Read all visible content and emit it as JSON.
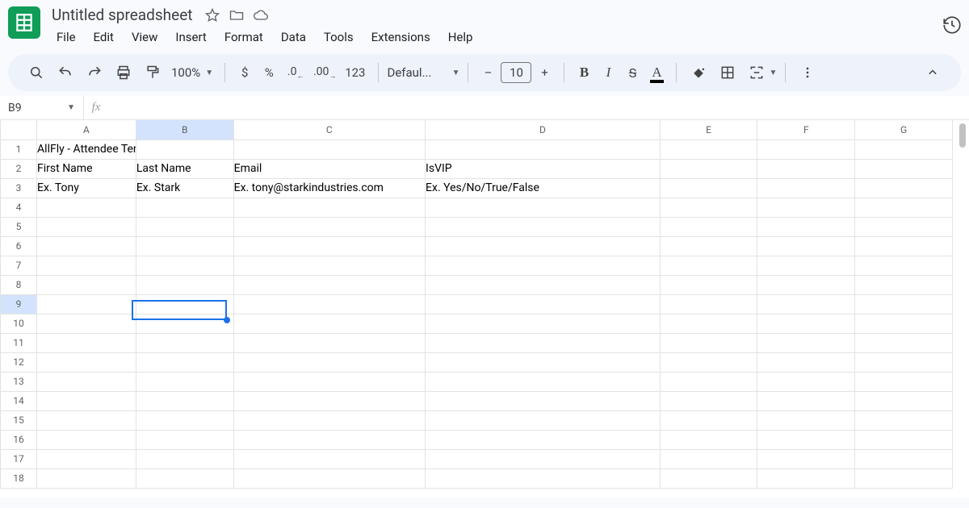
{
  "doc": {
    "title": "Untitled spreadsheet"
  },
  "menus": [
    "File",
    "Edit",
    "View",
    "Insert",
    "Format",
    "Data",
    "Tools",
    "Extensions",
    "Help"
  ],
  "toolbar": {
    "zoom": "100%",
    "currency": "$",
    "percent": "%",
    "dec_dec": ".0",
    "inc_dec": ".00",
    "num_fmt": "123",
    "font": "Defaul...",
    "minus": "–",
    "fontsize": "10",
    "plus": "+",
    "bold": "B",
    "italic": "I",
    "strike": "S",
    "textcolor": "A"
  },
  "namebox": "B9",
  "fx": "fx",
  "columns": [
    "A",
    "B",
    "C",
    "D",
    "E",
    "F",
    "G"
  ],
  "selected_col_index": 1,
  "selected_row_index": 8,
  "cells": {
    "r1": {
      "A": "AllFly - Attendee Template"
    },
    "r2": {
      "A": "First Name",
      "B": "Last Name",
      "C": "Email",
      "D": "IsVIP"
    },
    "r3": {
      "A": "Ex. Tony",
      "B": "Ex. Stark",
      "C": "Ex. tony@starkindustries.com",
      "D": "Ex. Yes/No/True/False"
    }
  },
  "row_count": 18
}
